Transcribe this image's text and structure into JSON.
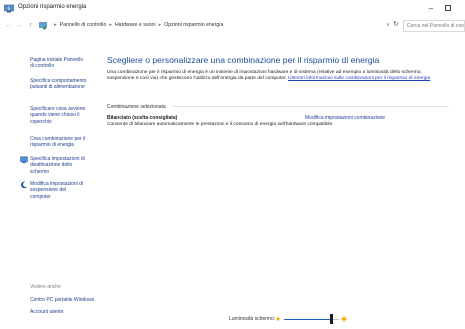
{
  "window": {
    "title": "Opzioni risparmio energia",
    "app_icon": "power-options-icon",
    "minimize_label": "–"
  },
  "address": {
    "breadcrumbs": [
      "Pannello di controllo",
      "Hardware e suoni",
      "Opzioni risparmio energia"
    ],
    "search_placeholder": "Cerca nel Pannello di controllo"
  },
  "sidebar": {
    "links": [
      {
        "label": "Pagina iniziale Pannello di controllo",
        "icon": null
      },
      {
        "label": "Specifica comportamento pulsanti di alimentazione",
        "icon": null
      },
      {
        "label": "Specificare cosa avviene quando viene chiuso il coperchio",
        "icon": null
      },
      {
        "label": "Crea combinazione per il risparmio di energia",
        "icon": null
      },
      {
        "label": "Specifica impostazioni di disattivazione dello schermo",
        "icon": "display-icon"
      },
      {
        "label": "Modifica impostazioni di sospensione del computer",
        "icon": "moon-icon"
      }
    ],
    "see_also": "Vedere anche",
    "bottom_links": [
      "Centro PC portatile Windows",
      "Account utente"
    ]
  },
  "main": {
    "heading": "Scegliere o personalizzare una combinazione per il risparmio di energia",
    "intro": "Una combinazione per il risparmio di energia è un insieme di impostazioni hardware e di sistema (relative ad esempio a luminosità dello schermo, sospensione e così via) che gestiscono l'utilizzo dell'energia da parte del computer.",
    "more_link": "Ulteriori informazioni sulle combinazioni per il risparmio di energia",
    "section_label": "Combinazione selezionata",
    "plan": {
      "name": "Bilanciato (scelta consigliata)",
      "change_link": "Modifica impostazioni combinazione",
      "description": "Consente di bilanciare automaticamente le prestazioni e il consumo di energia sull'hardware compatibile."
    }
  },
  "brightness": {
    "label": "Luminosità schermo:",
    "level": 0.85,
    "accent": "#1f5fbf"
  }
}
